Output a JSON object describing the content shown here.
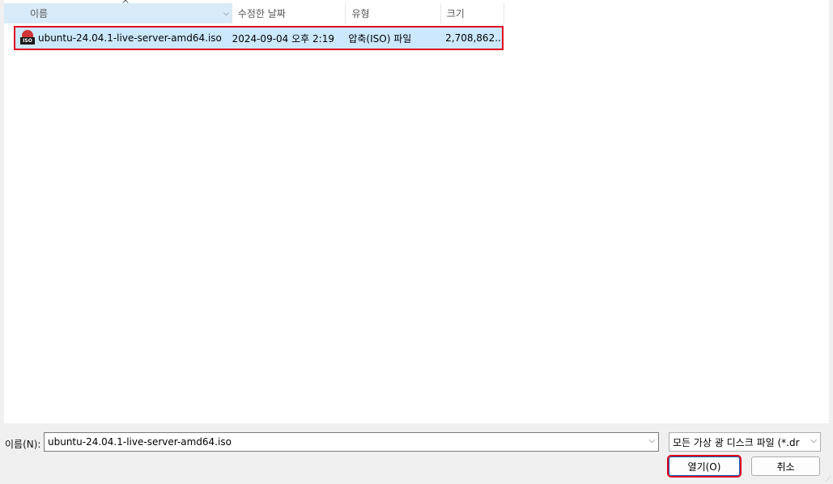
{
  "columns": {
    "name": "이름",
    "date": "수정한 날짜",
    "type": "유형",
    "size": "크기"
  },
  "files": [
    {
      "name": "ubuntu-24.04.1-live-server-amd64.iso",
      "date": "2024-09-04 오후 2:19",
      "type": "압축(ISO) 파일",
      "size": "2,708,862..."
    }
  ],
  "icons": {
    "file": "iso-file-icon",
    "sort": "sort-ascending-caret-icon",
    "column_menu": "chevron-down-icon"
  },
  "footer": {
    "filename_label": "이름(N):",
    "filename_value": "ubuntu-24.04.1-live-server-amd64.iso",
    "filter_value": "모든 가상 광 디스크 파일 (*.dr",
    "open_label": "열기(O)",
    "cancel_label": "취소"
  },
  "colors": {
    "selection": "#cce8ff",
    "highlight_box": "#e3001b",
    "header_active": "#d9ebf9"
  }
}
